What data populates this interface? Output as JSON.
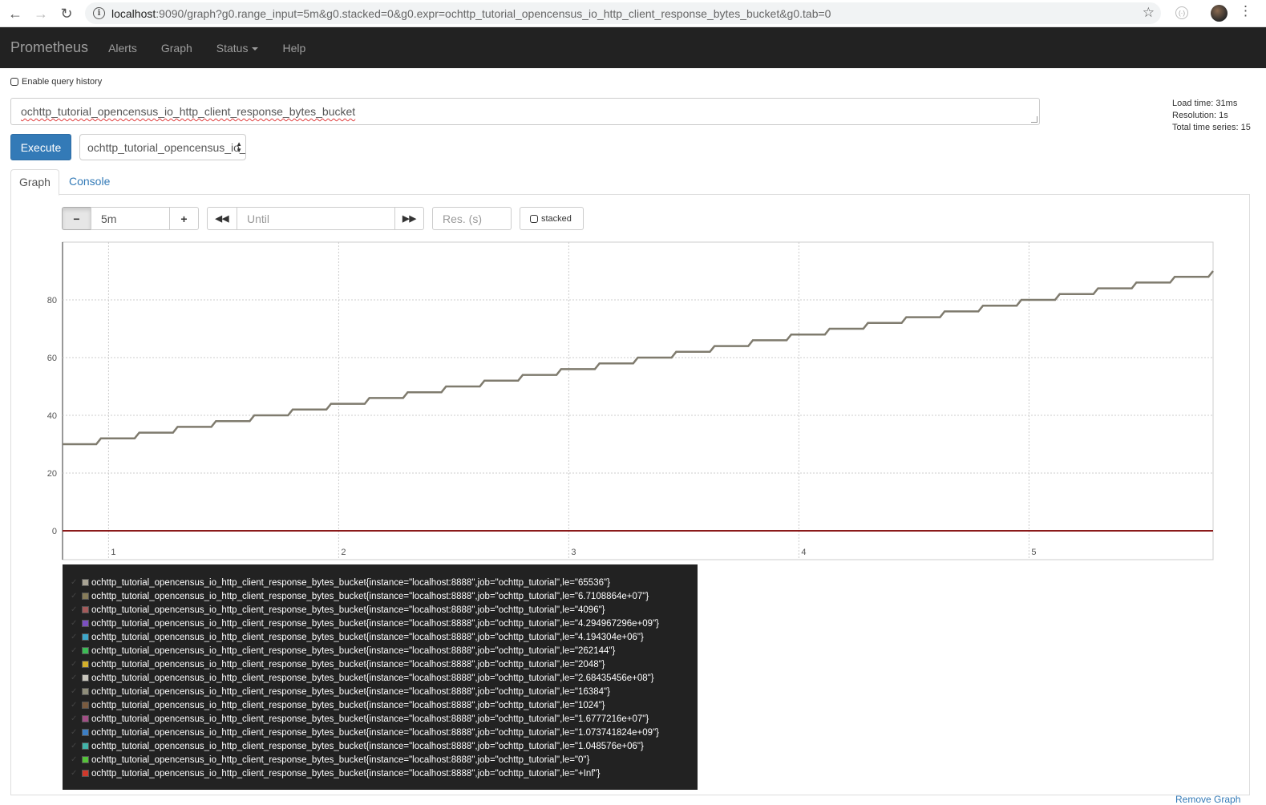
{
  "browser": {
    "url_host": "localhost",
    "url_rest": ":9090/graph?g0.range_input=5m&g0.stacked=0&g0.expr=ochttp_tutorial_opencensus_io_http_client_response_bytes_bucket&g0.tab=0",
    "icons": [
      "back-arrow",
      "forward-arrow",
      "reload",
      "info",
      "star",
      "extension",
      "avatar",
      "menu"
    ]
  },
  "navbar": {
    "brand": "Prometheus",
    "links": [
      "Alerts",
      "Graph",
      "Status",
      "Help"
    ]
  },
  "query": {
    "history_label": "Enable query history",
    "expression": "ochttp_tutorial_opencensus_io_http_client_response_bytes_bucket",
    "execute_label": "Execute",
    "metric_select": "ochttp_tutorial_opencensus_io_http_client_response_bytes_bucket",
    "stats": {
      "load_time": "Load time: 31ms",
      "resolution": "Resolution: 1s",
      "total_series": "Total time series: 15"
    }
  },
  "tabs": {
    "graph": "Graph",
    "console": "Console",
    "active": "Graph"
  },
  "graph_controls": {
    "range": "5m",
    "minus": "−",
    "plus": "+",
    "until_placeholder": "Until",
    "res_placeholder": "Res. (s)",
    "stacked_label": "stacked"
  },
  "chart_data": {
    "type": "line",
    "y_ticks": [
      "0",
      "20",
      "40",
      "60",
      "80"
    ],
    "x_ticks": [
      "1",
      "2",
      "3",
      "4",
      "5"
    ],
    "ylim": [
      -10,
      100
    ],
    "xlim": [
      0.8,
      5.8
    ],
    "grid": true,
    "series": [
      {
        "name": "step",
        "color": "#7f7b6e",
        "start": 30,
        "step": 2,
        "steps": 30,
        "end_value": 90
      },
      {
        "name": "zero",
        "color": "#8b1a1a",
        "value": 0
      }
    ]
  },
  "legend": {
    "metric": "ochttp_tutorial_opencensus_io_http_client_response_bytes_bucket",
    "items": [
      {
        "label": "ochttp_tutorial_opencensus_io_http_client_response_bytes_bucket{instance=\"localhost:8888\",job=\"ochttp_tutorial\",le=\"65536\"}",
        "color": "#a8a394"
      },
      {
        "label": "ochttp_tutorial_opencensus_io_http_client_response_bytes_bucket{instance=\"localhost:8888\",job=\"ochttp_tutorial\",le=\"6.7108864e+07\"}",
        "color": "#877c5a"
      },
      {
        "label": "ochttp_tutorial_opencensus_io_http_client_response_bytes_bucket{instance=\"localhost:8888\",job=\"ochttp_tutorial\",le=\"4096\"}",
        "color": "#a45a5a"
      },
      {
        "label": "ochttp_tutorial_opencensus_io_http_client_response_bytes_bucket{instance=\"localhost:8888\",job=\"ochttp_tutorial\",le=\"4.294967296e+09\"}",
        "color": "#7b4fc0"
      },
      {
        "label": "ochttp_tutorial_opencensus_io_http_client_response_bytes_bucket{instance=\"localhost:8888\",job=\"ochttp_tutorial\",le=\"4.194304e+06\"}",
        "color": "#3ea6c9"
      },
      {
        "label": "ochttp_tutorial_opencensus_io_http_client_response_bytes_bucket{instance=\"localhost:8888\",job=\"ochttp_tutorial\",le=\"262144\"}",
        "color": "#3dbb56"
      },
      {
        "label": "ochttp_tutorial_opencensus_io_http_client_response_bytes_bucket{instance=\"localhost:8888\",job=\"ochttp_tutorial\",le=\"2048\"}",
        "color": "#d4b02b"
      },
      {
        "label": "ochttp_tutorial_opencensus_io_http_client_response_bytes_bucket{instance=\"localhost:8888\",job=\"ochttp_tutorial\",le=\"2.68435456e+08\"}",
        "color": "#c9c6bd"
      },
      {
        "label": "ochttp_tutorial_opencensus_io_http_client_response_bytes_bucket{instance=\"localhost:8888\",job=\"ochttp_tutorial\",le=\"16384\"}",
        "color": "#8f8d7a"
      },
      {
        "label": "ochttp_tutorial_opencensus_io_http_client_response_bytes_bucket{instance=\"localhost:8888\",job=\"ochttp_tutorial\",le=\"1024\"}",
        "color": "#7a5b3f"
      },
      {
        "label": "ochttp_tutorial_opencensus_io_http_client_response_bytes_bucket{instance=\"localhost:8888\",job=\"ochttp_tutorial\",le=\"1.6777216e+07\"}",
        "color": "#a24f86"
      },
      {
        "label": "ochttp_tutorial_opencensus_io_http_client_response_bytes_bucket{instance=\"localhost:8888\",job=\"ochttp_tutorial\",le=\"1.073741824e+09\"}",
        "color": "#3c7ec4"
      },
      {
        "label": "ochttp_tutorial_opencensus_io_http_client_response_bytes_bucket{instance=\"localhost:8888\",job=\"ochttp_tutorial\",le=\"1.048576e+06\"}",
        "color": "#42b3a9"
      },
      {
        "label": "ochttp_tutorial_opencensus_io_http_client_response_bytes_bucket{instance=\"localhost:8888\",job=\"ochttp_tutorial\",le=\"0\"}",
        "color": "#55c23a"
      },
      {
        "label": "ochttp_tutorial_opencensus_io_http_client_response_bytes_bucket{instance=\"localhost:8888\",job=\"ochttp_tutorial\",le=\"+Inf\"}",
        "color": "#d0392c"
      }
    ]
  },
  "footer": {
    "link": "Remove Graph"
  }
}
